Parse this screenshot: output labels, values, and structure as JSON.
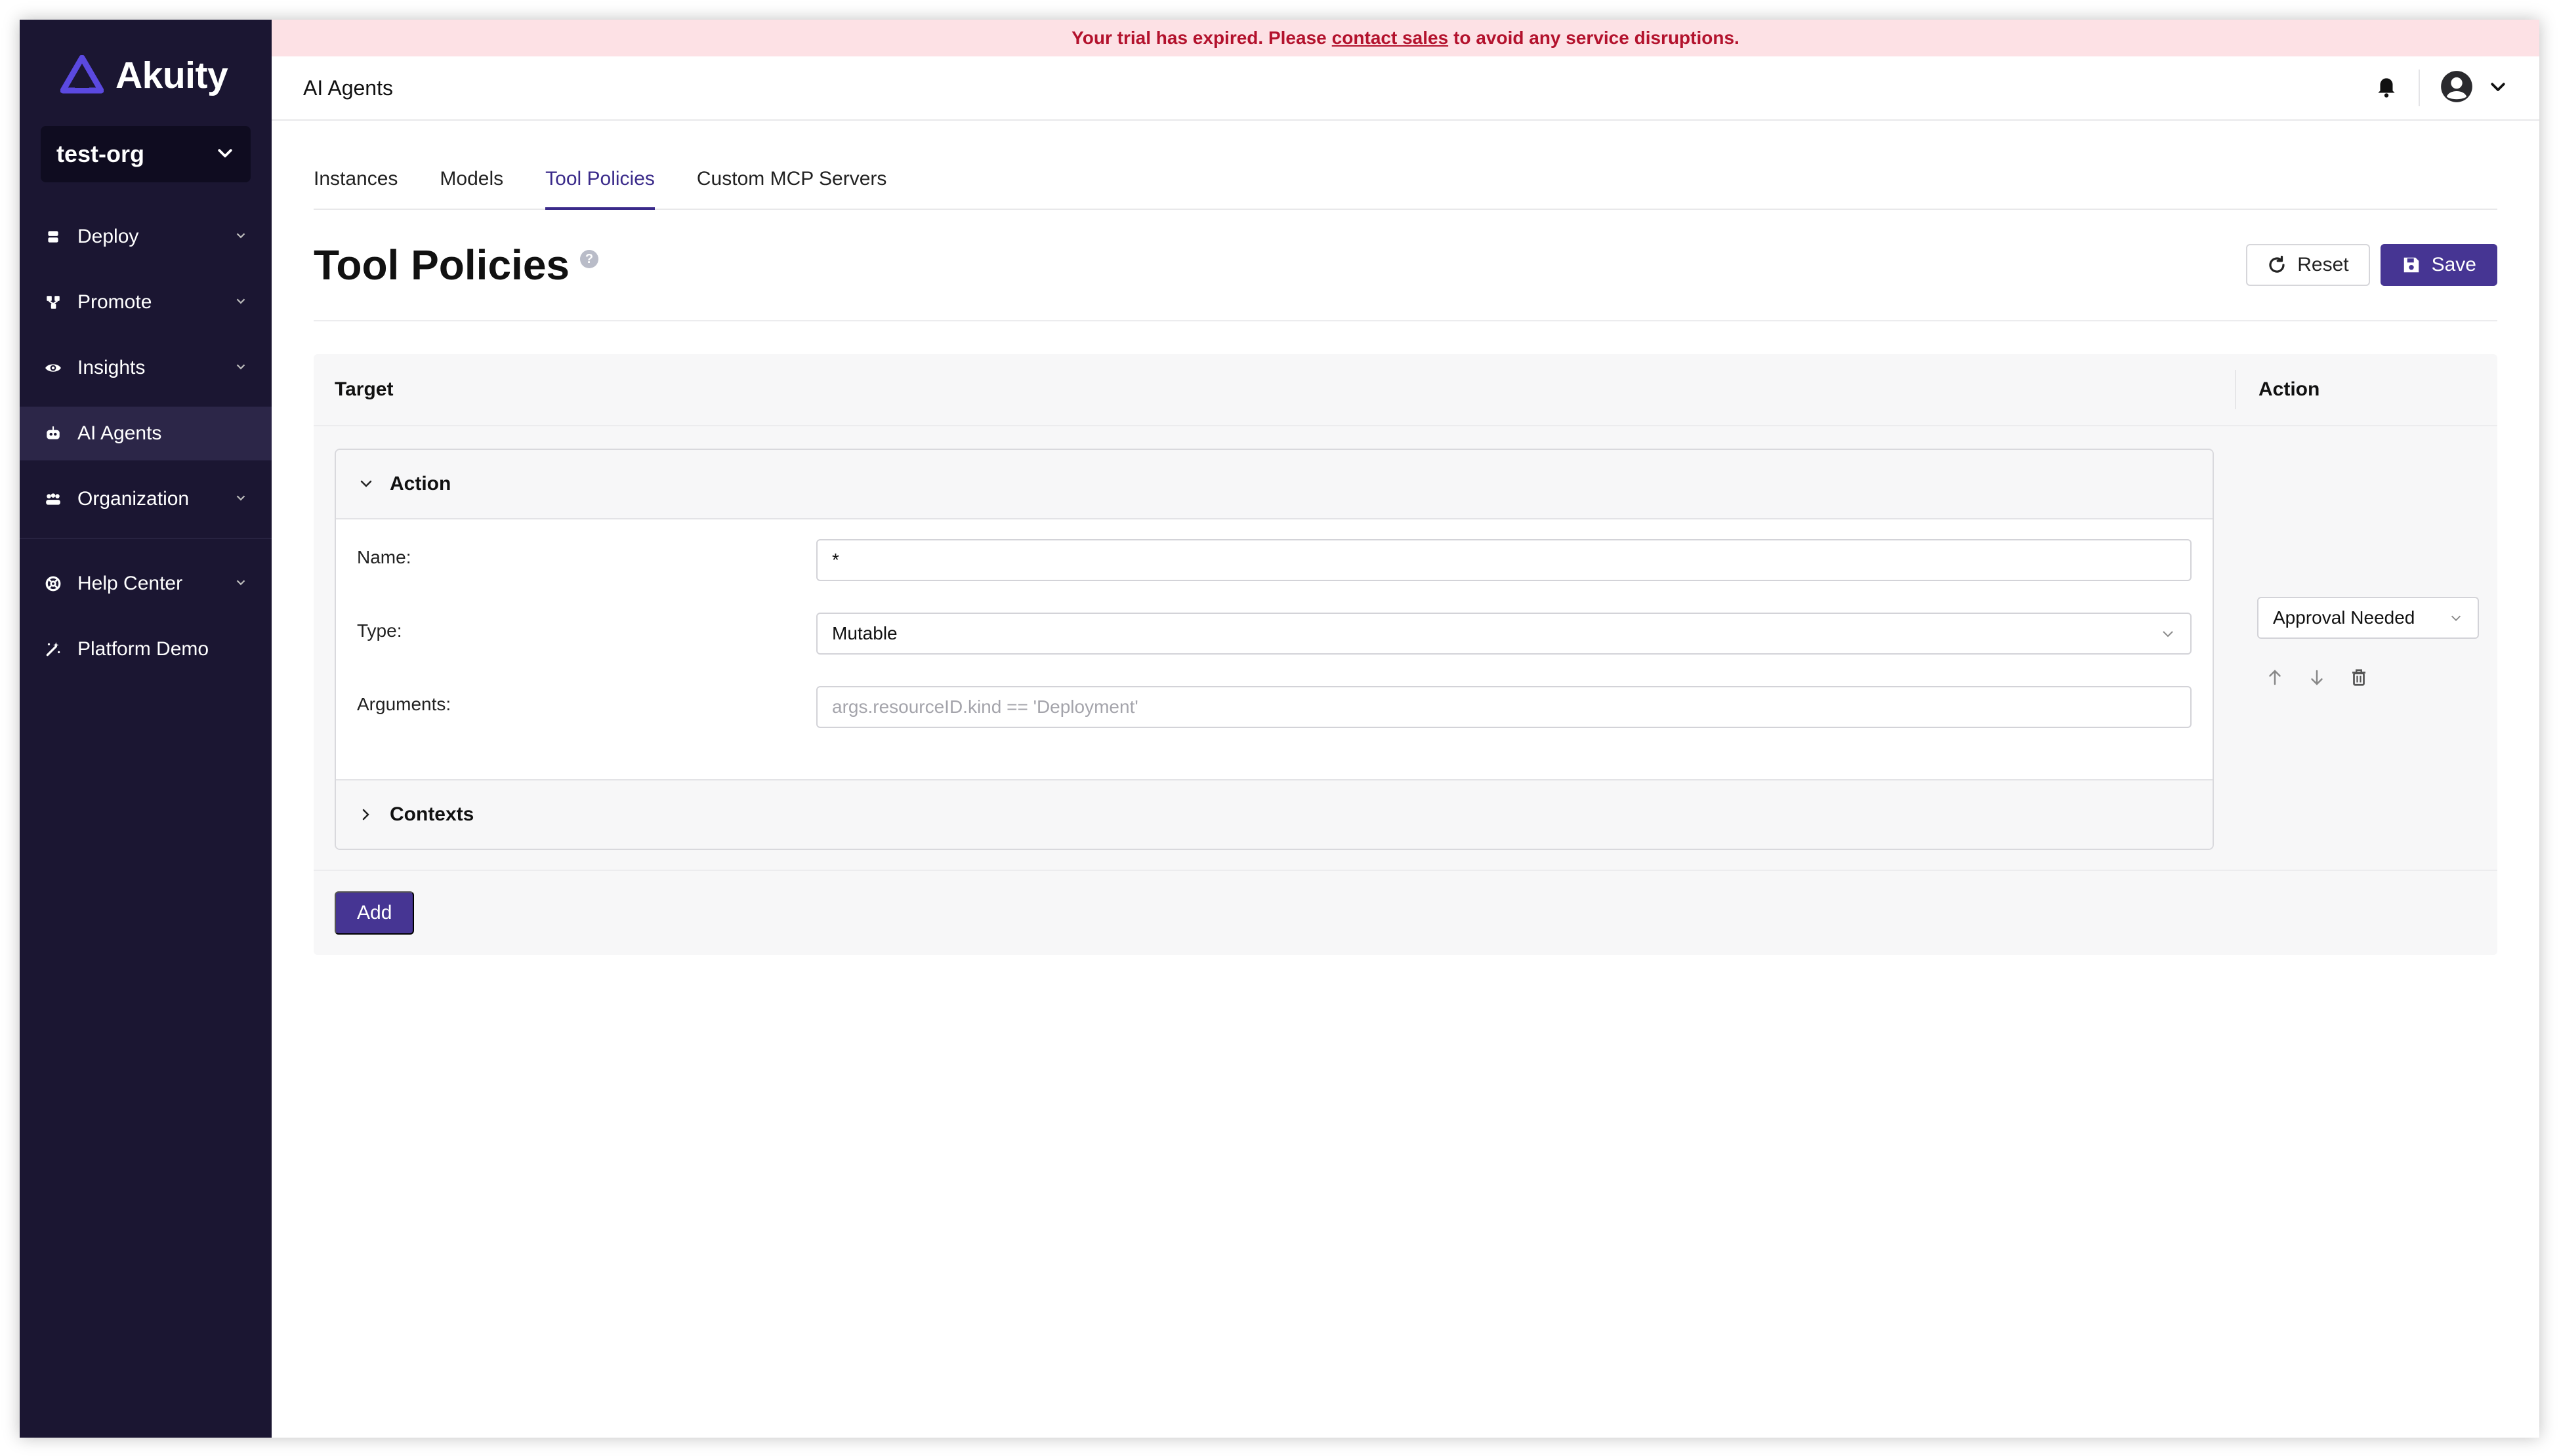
{
  "brand": {
    "name": "Akuity",
    "accent": "#463593",
    "sidebar_bg": "#1b1632"
  },
  "org": {
    "name": "test-org"
  },
  "sidebar": {
    "items": [
      {
        "label": "Deploy",
        "icon": "deploy-icon",
        "expandable": true
      },
      {
        "label": "Promote",
        "icon": "promote-icon",
        "expandable": true
      },
      {
        "label": "Insights",
        "icon": "eye-icon",
        "expandable": true
      },
      {
        "label": "AI Agents",
        "icon": "robot-icon",
        "expandable": false,
        "active": true
      },
      {
        "label": "Organization",
        "icon": "users-icon",
        "expandable": true
      }
    ],
    "secondary": [
      {
        "label": "Help Center",
        "icon": "lifebuoy-icon",
        "expandable": true
      },
      {
        "label": "Platform Demo",
        "icon": "magic-wand-icon",
        "expandable": false
      }
    ]
  },
  "banner": {
    "prefix": "Your trial has expired. Please",
    "link": "contact sales",
    "suffix": "to avoid any service disruptions.",
    "color": "#b3122d"
  },
  "topbar": {
    "title": "AI Agents"
  },
  "tabs": [
    {
      "label": "Instances"
    },
    {
      "label": "Models"
    },
    {
      "label": "Tool Policies",
      "active": true
    },
    {
      "label": "Custom MCP Servers"
    }
  ],
  "page": {
    "title": "Tool Policies",
    "help": "?",
    "reset_label": "Reset",
    "save_label": "Save"
  },
  "table": {
    "col_target": "Target",
    "col_action": "Action",
    "row": {
      "action_section": "Action",
      "name_label": "Name:",
      "name_value": "*",
      "type_label": "Type:",
      "type_value": "Mutable",
      "args_label": "Arguments:",
      "args_placeholder": "args.resourceID.kind == 'Deployment'",
      "contexts_section": "Contexts",
      "action_value": "Approval Needed"
    },
    "add_label": "Add"
  }
}
